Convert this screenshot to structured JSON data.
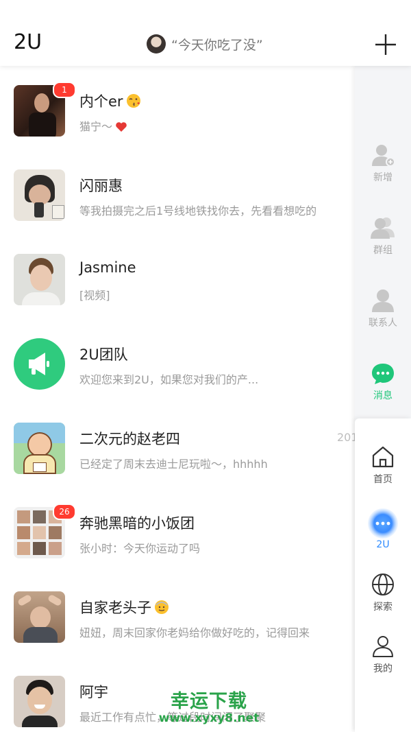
{
  "header": {
    "app_name": "2U",
    "status_text": "“今天你吃了没”",
    "add_icon": "plus-icon"
  },
  "chats": [
    {
      "name": "内个er",
      "emoji": "kiss-face-emoji",
      "message": "猫宁～",
      "message_emoji": "heart-emoji",
      "badge": "1",
      "time": ""
    },
    {
      "name": "闪丽惠",
      "message": "等我拍摄完之后1号线地铁找你去，先看看想吃的",
      "time": ""
    },
    {
      "name": "Jasmine",
      "message": "[视频]",
      "time": ""
    },
    {
      "name": "2U团队",
      "message": "欢迎您来到2U，如果您对我们的产...",
      "time": ""
    },
    {
      "name": "二次元的赵老四",
      "message": "已经定了周末去迪士尼玩啦～，hhhhh",
      "time": "201"
    },
    {
      "name": "奔驰黑暗的小饭团",
      "message": "张小时：今天你运动了吗",
      "badge": "26",
      "time": ""
    },
    {
      "name": "自家老头子",
      "emoji": "old-man-emoji",
      "message": "妞妞，周末回家你老妈给你做好吃的，记得回来",
      "time": ""
    },
    {
      "name": "阿宇",
      "message": "最近工作有点忙，等过段时间闲了聚聚",
      "time": ""
    }
  ],
  "side_nav_top": [
    {
      "label": "新增",
      "icon": "add-person-icon"
    },
    {
      "label": "群组",
      "icon": "group-icon"
    },
    {
      "label": "联系人",
      "icon": "contact-icon"
    },
    {
      "label": "消息",
      "icon": "chat-bubble-icon",
      "active": true
    }
  ],
  "side_nav_bottom": [
    {
      "label": "首页",
      "icon": "home-icon"
    },
    {
      "label": "2U",
      "icon": "more-dots-icon",
      "active": true
    },
    {
      "label": "探索",
      "icon": "globe-icon"
    },
    {
      "label": "我的",
      "icon": "profile-icon"
    }
  ],
  "watermark": {
    "line1": "幸运下载",
    "line2": "www.xyxy8.net"
  },
  "colors": {
    "accent_green": "#1fc67a",
    "accent_blue": "#2e8bff",
    "badge_red": "#ff3b30"
  }
}
